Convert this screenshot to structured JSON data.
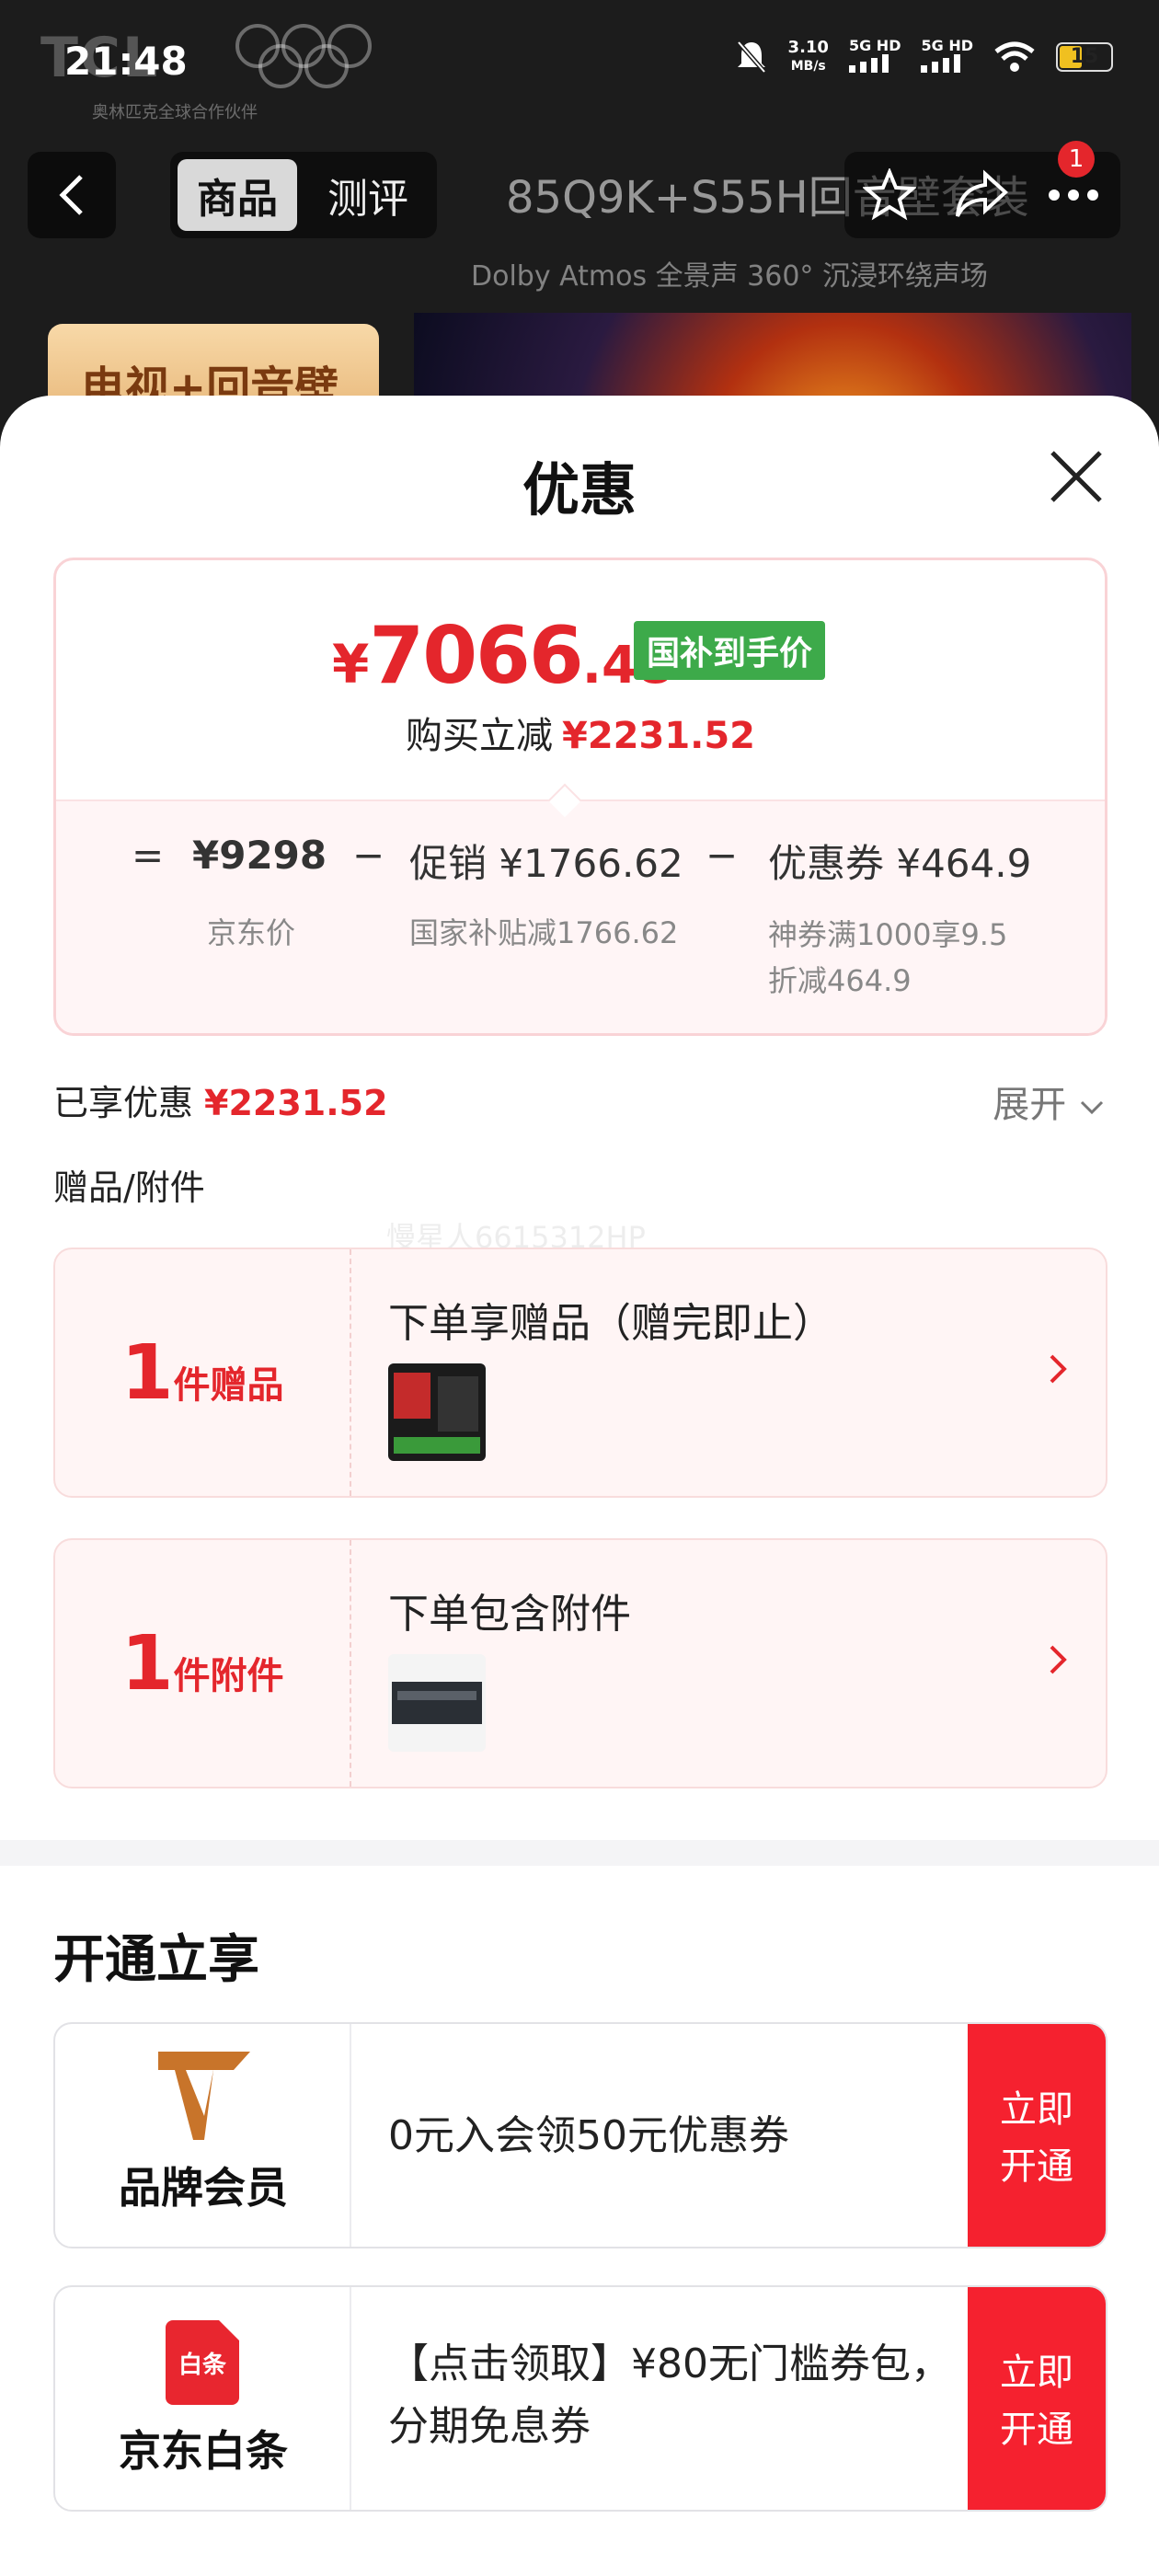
{
  "status_bar": {
    "time": "21:48",
    "net_speed": "3.10",
    "net_unit": "MB/s",
    "signal1": "5G HD",
    "signal2": "5G HD",
    "battery": "15"
  },
  "background": {
    "brand": "TCL",
    "brand_sub": "奥林匹克全球合作伙伴",
    "tabs": [
      "商品",
      "测评"
    ],
    "product_title": "85Q9K+S55H回音壁套装",
    "cart_badge": "1",
    "dolby": "Dolby Atmos 全景声   360° 沉浸环绕声场",
    "tag": "电视+回音壁"
  },
  "sheet": {
    "title": "优惠",
    "price": {
      "yen": "¥",
      "integer": "7066",
      "decimal": ".48",
      "badge": "国补到手价",
      "reduce_label": "购买立减",
      "reduce_value": "¥2231.52"
    },
    "breakdown": {
      "eq": "=",
      "jd_price": "¥9298",
      "jd_label": "京东价",
      "minus1": "−",
      "promo": "促销 ¥1766.62",
      "promo_note": "国家补贴减1766.62",
      "minus2": "−",
      "coupon": "优惠券 ¥464.9",
      "coupon_note1": "神券满1000享9.5",
      "coupon_note2": "折减464.9"
    },
    "enjoyed_label": "已享优惠",
    "enjoyed_value": "¥2231.52",
    "expand_label": "展开",
    "gifts_header": "赠品/附件",
    "watermark": "慢星人6615312HP",
    "gift_cards": [
      {
        "num": "1",
        "unit": "件赠品",
        "title": "下单享赠品（赠完即止）"
      },
      {
        "num": "1",
        "unit": "件附件",
        "title": "下单包含附件"
      }
    ],
    "open_header": "开通立享",
    "member_cards": [
      {
        "name": "品牌会员",
        "desc1": "0元入会领50元优惠券",
        "desc2": "",
        "btn1": "立即",
        "btn2": "开通"
      },
      {
        "name": "京东白条",
        "icon_text": "白条",
        "desc1": "【点击领取】¥80无门槛券包，",
        "desc2": "分期免息券",
        "btn1": "立即",
        "btn2": "开通"
      }
    ]
  },
  "colors": {
    "accent_red": "#e4262c",
    "green_badge": "#3daa4a",
    "button_red": "#f5212f"
  }
}
